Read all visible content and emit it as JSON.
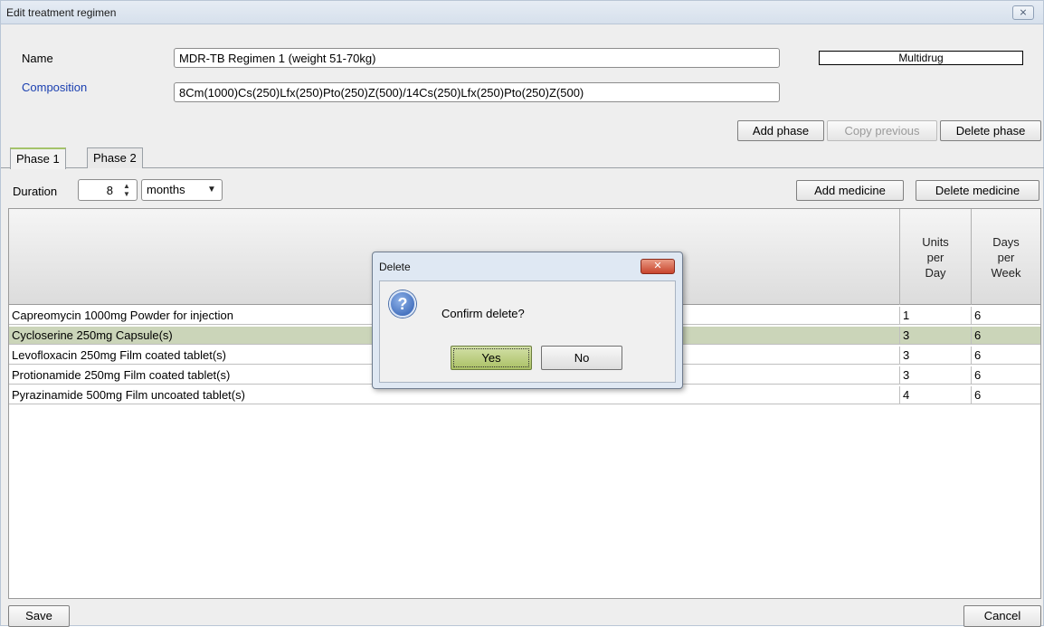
{
  "window": {
    "title": "Edit treatment regimen",
    "close_label": "⨯"
  },
  "form": {
    "name_label": "Name",
    "name_value": "MDR-TB Regimen 1 (weight 51-70kg)",
    "composition_label": "Composition",
    "composition_value": "8Cm(1000)Cs(250)Lfx(250)Pto(250)Z(500)/14Cs(250)Lfx(250)Pto(250)Z(500)",
    "type_value": "Multidrug"
  },
  "phase_buttons": {
    "add": "Add phase",
    "copy": "Copy previous",
    "delete": "Delete phase"
  },
  "tabs": [
    {
      "label": "Phase 1"
    },
    {
      "label": "Phase 2"
    }
  ],
  "duration": {
    "label": "Duration",
    "value": "8",
    "unit": "months"
  },
  "medicine_buttons": {
    "add": "Add medicine",
    "delete": "Delete medicine"
  },
  "table": {
    "headers": {
      "medicine": "",
      "units_per_day": [
        "Units",
        "per",
        "Day"
      ],
      "days_per_week": [
        "Days",
        "per",
        "Week"
      ]
    },
    "rows": [
      {
        "medicine": "Capreomycin  1000mg  Powder for injection",
        "units": "1",
        "days": "6"
      },
      {
        "medicine": "Cycloserine  250mg  Capsule(s)",
        "units": "3",
        "days": "6"
      },
      {
        "medicine": "Levofloxacin  250mg  Film coated tablet(s)",
        "units": "3",
        "days": "6"
      },
      {
        "medicine": "Protionamide   250mg  Film coated tablet(s)",
        "units": "3",
        "days": "6"
      },
      {
        "medicine": "Pyrazinamide  500mg  Film uncoated tablet(s)",
        "units": "4",
        "days": "6"
      }
    ],
    "selected_row_index": 1
  },
  "dialog": {
    "title": "Delete",
    "message": "Confirm delete?",
    "yes_label": "Yes",
    "no_label": "No",
    "close_label": "✕"
  },
  "footer": {
    "save": "Save",
    "cancel": "Cancel"
  },
  "colors": {
    "selected_row": "#cbd5b9",
    "active_tab_accent": "#a4c36a",
    "composition_label": "#1a3fb0"
  }
}
